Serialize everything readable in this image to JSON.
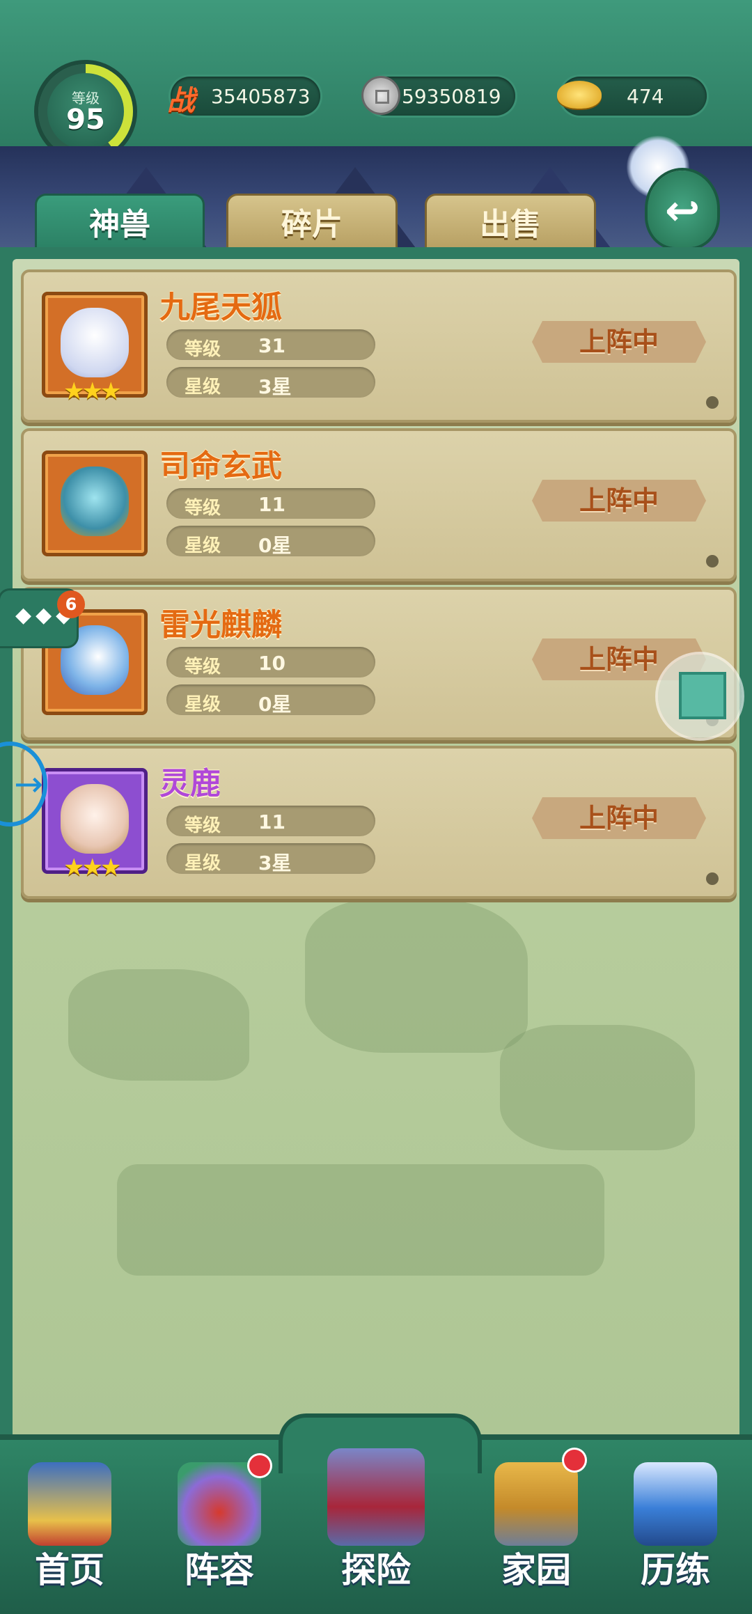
{
  "header": {
    "level_label": "等级",
    "level_value": "95",
    "level_progress": 0.4,
    "power_icon_text": "战",
    "power": "35405873",
    "silver": "59350819",
    "gold": "474"
  },
  "tabs": [
    {
      "label": "神兽",
      "active": true
    },
    {
      "label": "碎片",
      "active": false
    },
    {
      "label": "出售",
      "active": false
    }
  ],
  "beasts": [
    {
      "name": "九尾天狐",
      "level_key": "等级",
      "level": "31",
      "star_key": "星级",
      "star": "3星",
      "stars_shown": 3,
      "frame": "orange",
      "button": "上阵中"
    },
    {
      "name": "司命玄武",
      "level_key": "等级",
      "level": "11",
      "star_key": "星级",
      "star": "0星",
      "stars_shown": 0,
      "frame": "orange",
      "button": "上阵中"
    },
    {
      "name": "雷光麒麟",
      "level_key": "等级",
      "level": "10",
      "star_key": "星级",
      "star": "0星",
      "stars_shown": 0,
      "frame": "orange",
      "button": "上阵中"
    },
    {
      "name": "灵鹿",
      "level_key": "等级",
      "level": "11",
      "star_key": "星级",
      "star": "3星",
      "stars_shown": 3,
      "frame": "purple",
      "button": "上阵中"
    }
  ],
  "overlay": {
    "chat_badge": "6"
  },
  "bottom_nav": [
    {
      "label": "首页",
      "has_dot": false
    },
    {
      "label": "阵容",
      "has_dot": true
    },
    {
      "label": "探险",
      "has_dot": false
    },
    {
      "label": "家园",
      "has_dot": true
    },
    {
      "label": "历练",
      "has_dot": false
    }
  ],
  "colors": {
    "accent_green": "#2e7b61",
    "name_orange": "#e46a12",
    "name_purple": "#b048d8",
    "star_gold": "#ffd21d",
    "notification_red": "#e4303a"
  }
}
